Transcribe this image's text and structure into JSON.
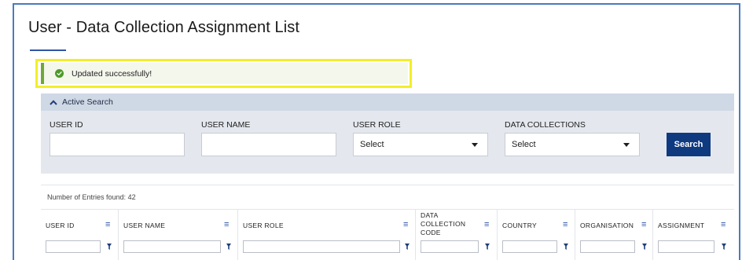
{
  "page": {
    "title": "User - Data Collection Assignment List"
  },
  "alert": {
    "message": "Updated successfully!",
    "type": "success",
    "accent_color": "#6ea736",
    "icon": "check-circle-icon"
  },
  "search": {
    "header_label": "Active Search",
    "fields": {
      "user_id": {
        "label": "USER ID",
        "value": ""
      },
      "user_name": {
        "label": "USER NAME",
        "value": ""
      },
      "user_role": {
        "label": "USER ROLE",
        "value": "Select"
      },
      "data_collections": {
        "label": "DATA COLLECTIONS",
        "value": "Select"
      }
    },
    "button_label": "Search",
    "button_color": "#103a80"
  },
  "results": {
    "entries_label": "Number of Entries found:",
    "entries_count": "42",
    "columns": [
      {
        "key": "user_id",
        "label": "USER ID"
      },
      {
        "key": "user_name",
        "label": "USER NAME"
      },
      {
        "key": "user_role",
        "label": "USER ROLE"
      },
      {
        "key": "data_collection_code",
        "label_lines": [
          "DATA",
          "COLLECTION",
          "CODE"
        ]
      },
      {
        "key": "country",
        "label": "COUNTRY"
      },
      {
        "key": "organisation",
        "label": "ORGANISATION"
      },
      {
        "key": "assignment",
        "label": "ASSIGNMENT"
      }
    ]
  }
}
